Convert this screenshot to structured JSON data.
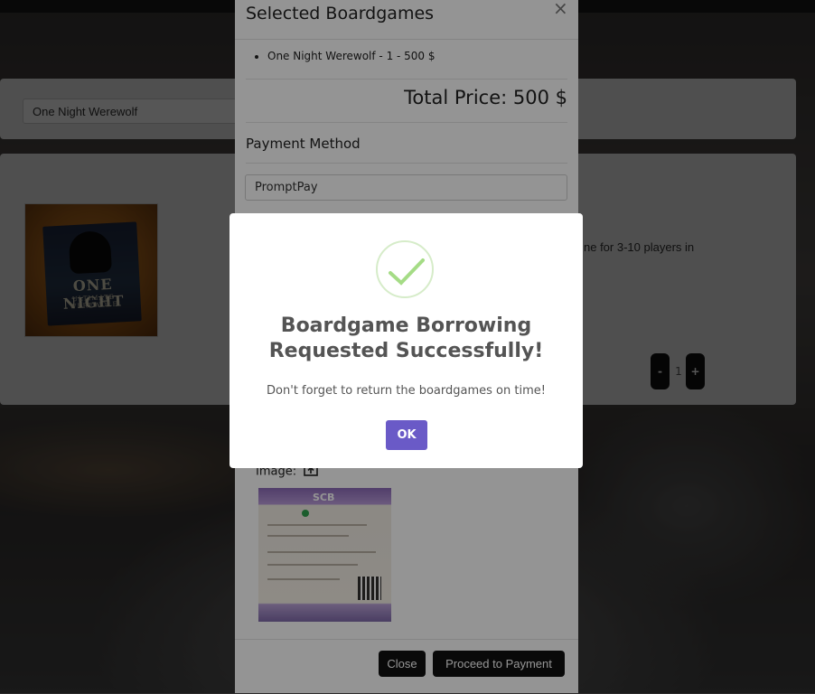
{
  "background_page": {
    "search": {
      "value": "One Night Werewolf"
    },
    "game": {
      "thumbnail": {
        "title": "ONE NIGHT",
        "subtitle": "ULTIMATE WEREWOLF"
      },
      "description_fragment": "ne for 3-10 players in",
      "quantity": {
        "minus": "-",
        "value": "1",
        "plus": "+"
      }
    }
  },
  "modal": {
    "title": "Selected Boardgames",
    "close_glyph": "×",
    "items": [
      "One Night Werewolf - 1 - 500 $"
    ],
    "total_price": "Total Price: 500 $",
    "payment_method_title": "Payment Method",
    "payment_method_value": "PromptPay",
    "image_label": "Image:",
    "slip": {
      "bank": "SCB"
    },
    "footer": {
      "close_label": "Close",
      "proceed_label": "Proceed to Payment"
    }
  },
  "alert": {
    "icon": "success-check-icon",
    "title_line1": "Boardgame Borrowing",
    "title_line2": "Requested Successfully!",
    "text": "Don't forget to return the boardgames on time!",
    "ok_label": "OK",
    "colors": {
      "ok_button": "#6a5ac7",
      "check": "#a5dc86"
    }
  }
}
